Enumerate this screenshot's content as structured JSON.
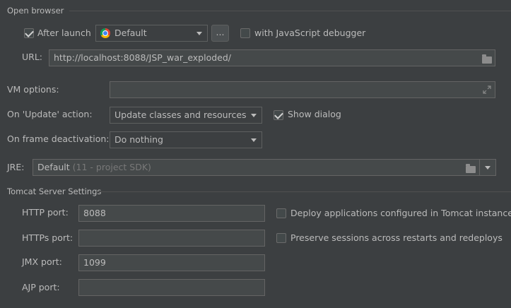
{
  "open_browser": {
    "section_title": "Open browser",
    "after_launch": {
      "label": "After launch",
      "checked": true
    },
    "browser": {
      "value": "Default",
      "icon": "chrome-icon"
    },
    "dots_label": "...",
    "js_debugger": {
      "label": "with JavaScript debugger",
      "checked": false
    },
    "url": {
      "label": "URL:",
      "value": "http://localhost:8088/JSP_war_exploded/"
    }
  },
  "vm_options": {
    "label": "VM options:",
    "value": ""
  },
  "on_update": {
    "label": "On 'Update' action:",
    "value": "Update classes and resources"
  },
  "show_dialog": {
    "label": "Show dialog",
    "checked": true
  },
  "on_frame": {
    "label": "On frame deactivation:",
    "value": "Do nothing"
  },
  "jre": {
    "label": "JRE:",
    "value": "Default",
    "hint": "(11 - project SDK)"
  },
  "tomcat": {
    "section_title": "Tomcat Server Settings",
    "http_port": {
      "label": "HTTP port:",
      "value": "8088"
    },
    "https_port": {
      "label": "HTTPs port:",
      "value": ""
    },
    "jmx_port": {
      "label": "JMX port:",
      "value": "1099"
    },
    "ajp_port": {
      "label": "AJP port:",
      "value": ""
    },
    "deploy_apps": {
      "label": "Deploy applications configured in Tomcat instance",
      "checked": false
    },
    "preserve_sessions": {
      "label": "Preserve sessions across restarts and redeploys",
      "checked": false
    }
  },
  "colors": {
    "background": "#3c3f41",
    "text": "#bbbbbb",
    "field_bg": "#45494a",
    "border": "#646464"
  }
}
